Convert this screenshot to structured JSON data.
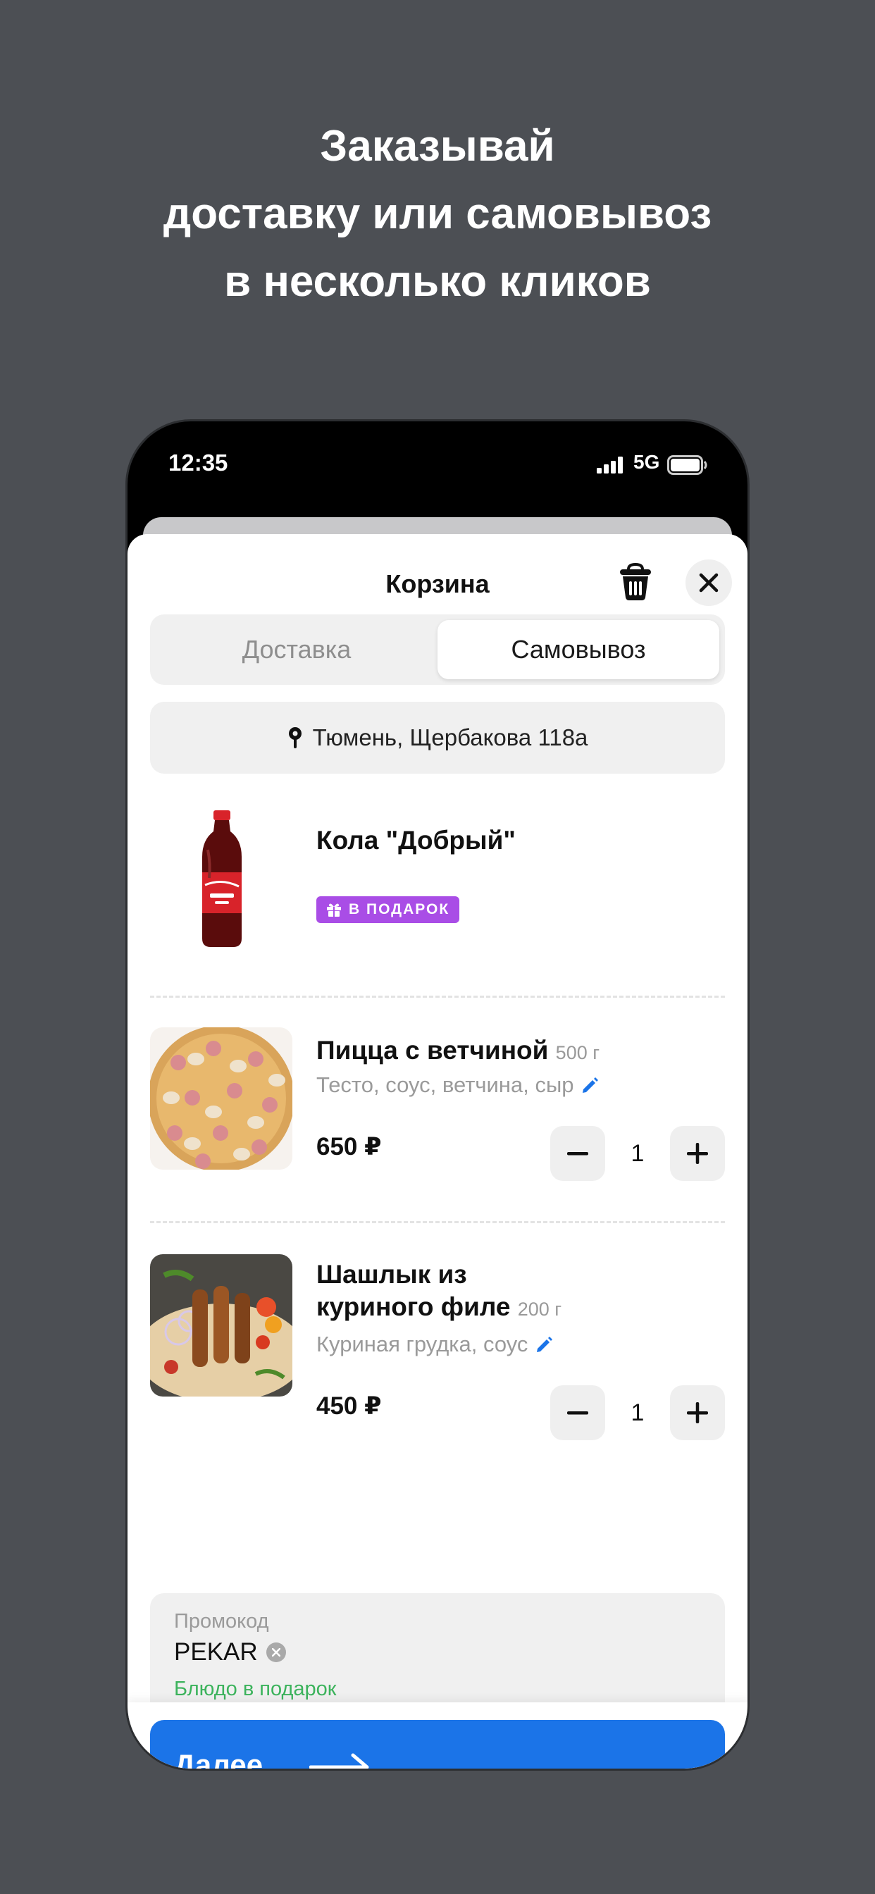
{
  "headline": {
    "line1": "Заказывай",
    "line2": "доставку или самовывоз",
    "line3": "в несколько кликов"
  },
  "status_bar": {
    "time": "12:35",
    "network": "5G",
    "icons": [
      "signal-icon",
      "battery-icon"
    ]
  },
  "cart": {
    "title": "Корзина",
    "icons": [
      "trash-icon",
      "close-icon"
    ],
    "tabs": [
      {
        "label": "Доставка",
        "selected": false
      },
      {
        "label": "Самовывоз",
        "selected": true
      }
    ],
    "address": "Тюмень, Щербакова 118а",
    "items": [
      {
        "name": "Кола \"Добрый\"",
        "badge": "В ПОДАРОК",
        "badge_color": "#a94de6"
      },
      {
        "name": "Пицца с ветчиной",
        "weight": "500 г",
        "description": "Тесто, соус, ветчина, сыр",
        "price": "650 ₽",
        "quantity": "1"
      },
      {
        "name_line1": "Шашлык из",
        "name_line2": "куриного филе",
        "weight": "200 г",
        "description": "Куриная грудка, соус",
        "price": "450 ₽",
        "quantity": "1"
      }
    ],
    "promo": {
      "label": "Промокод",
      "code": "PEKAR",
      "note": "Блюдо в подарок",
      "note_color": "#3cb35c"
    },
    "next_button": {
      "label": "Далее",
      "color": "#1b74e8"
    }
  }
}
